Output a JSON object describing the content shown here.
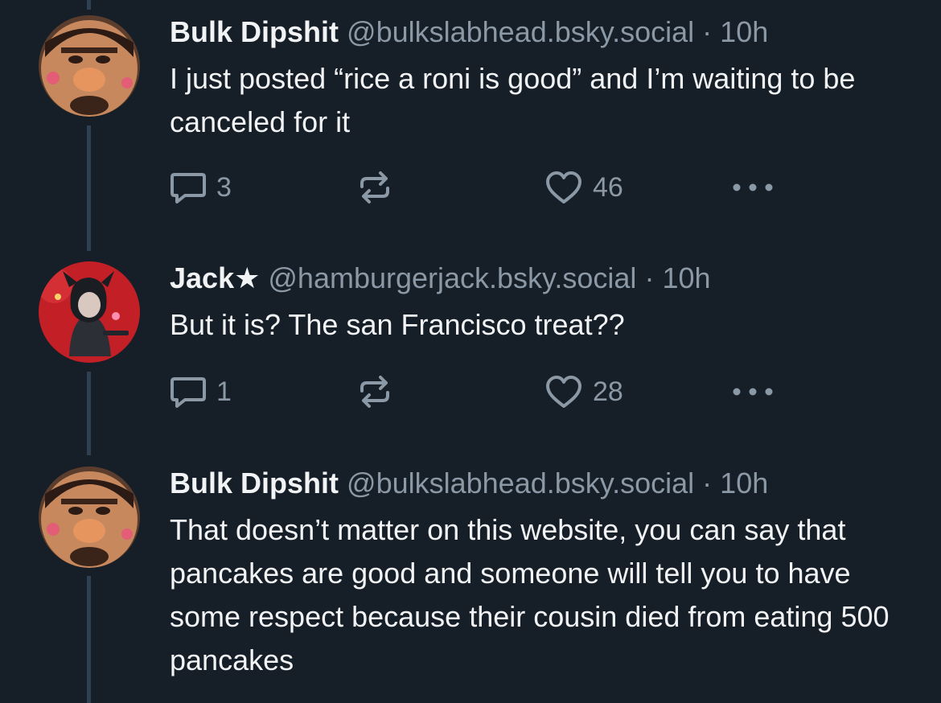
{
  "posts": [
    {
      "author_name": "Bulk Dipshit",
      "handle": "@bulkslabhead.bsky.social",
      "separator": "·",
      "time": "10h",
      "text": "I just posted “rice a roni is good” and I’m waiting to be canceled for it",
      "replies": "3",
      "likes": "46",
      "avatar": "bulk-dipshit-avatar"
    },
    {
      "author_name": "Jack★",
      "handle": "@hamburgerjack.bsky.social",
      "separator": "·",
      "time": "10h",
      "text": "But it is? The san Francisco treat??",
      "replies": "1",
      "likes": "28",
      "avatar": "jack-avatar"
    },
    {
      "author_name": "Bulk Dipshit",
      "handle": "@bulkslabhead.bsky.social",
      "separator": "·",
      "time": "10h",
      "text": "That doesn’t matter on this website, you can say that pancakes are good and someone will tell you to have some respect because their cousin died from eating 500 pancakes",
      "avatar": "bulk-dipshit-avatar"
    }
  ],
  "icons": {
    "reply": "speech-bubble-icon",
    "repost": "repost-arrows-icon",
    "like": "heart-outline-icon",
    "more": "ellipsis-icon"
  },
  "colors": {
    "background": "#161e27",
    "text_primary": "#f1f3f5",
    "text_secondary": "#8b98a5",
    "thread_line": "#2e4052"
  }
}
